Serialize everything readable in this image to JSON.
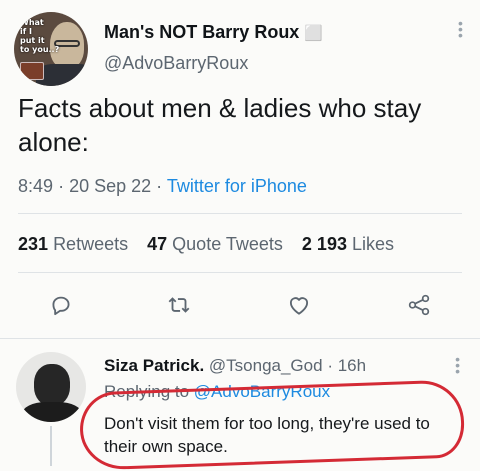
{
  "tweet": {
    "author_name": "Man's NOT Barry Roux",
    "author_badge": "⬜",
    "author_handle": "@AdvoBarryRoux",
    "avatar_caption": "What\nif I\nput it\nto you..?",
    "text": "Facts about men & ladies who stay alone:",
    "time": "8:49",
    "date": "20 Sep 22",
    "source": "Twitter for iPhone",
    "stats": {
      "retweets_count": "231",
      "retweets_label": "Retweets",
      "quotes_count": "47",
      "quotes_label": "Quote Tweets",
      "likes_count": "2 193",
      "likes_label": "Likes"
    }
  },
  "reply": {
    "author_name": "Siza Patrick.",
    "author_handle": "@Tsonga_God",
    "time": "16h",
    "replying_prefix": "Replying to",
    "replying_handle": "@AdvoBarryRoux",
    "text": "Don't visit them for too long, they're used to their own space."
  },
  "icons": [
    "reply-icon",
    "retweet-icon",
    "like-icon",
    "share-icon",
    "more-icon"
  ],
  "colors": {
    "link": "#1d8ae0",
    "annotation": "#d42a35",
    "muted": "#5c6670"
  }
}
